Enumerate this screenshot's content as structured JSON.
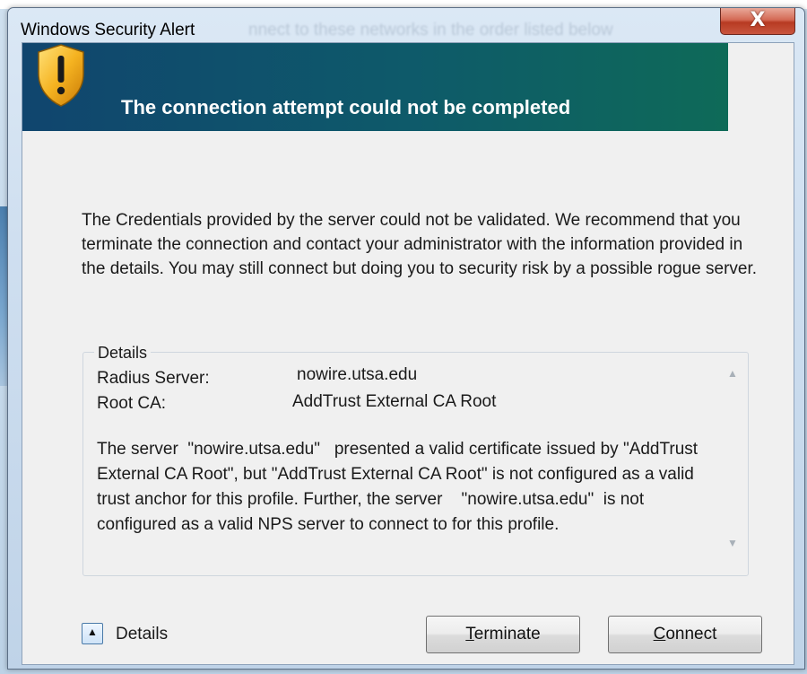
{
  "window": {
    "title": "Windows Security Alert",
    "background_ghost_text": "nnect to these networks in the order listed below",
    "close_symbol": "X"
  },
  "banner": {
    "icon": "shield-warning-icon",
    "title": "The connection attempt could not be completed",
    "colors": {
      "left": "#10456e",
      "right": "#0e6a58"
    }
  },
  "message": "The Credentials provided by the server could not be validated. We recommend that you terminate the connection and contact your administrator with the information provided in the details. You may still connect but doing you to security risk by a possible rogue server.",
  "details": {
    "legend": "Details",
    "rows": [
      {
        "key": "Radius Server:",
        "value": "nowire.utsa.edu"
      },
      {
        "key": "Root CA:",
        "value": "AddTrust External CA Root"
      }
    ],
    "paragraph": "The server  \"nowire.utsa.edu\"   presented a valid certificate issued by \"AddTrust External CA Root\", but \"AddTrust External CA Root\" is not configured as a valid trust anchor for this profile. Further, the server    \"nowire.utsa.edu\"  is not configured as a valid NPS server to connect to for this profile."
  },
  "footer": {
    "expander_label": "Details",
    "terminate_prefix": "T",
    "terminate_rest": "erminate",
    "connect_prefix": "C",
    "connect_rest": "onnect"
  }
}
